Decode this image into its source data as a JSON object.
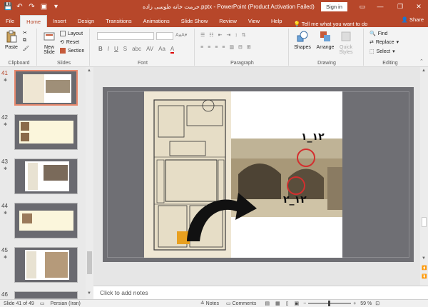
{
  "titlebar": {
    "title": "حرمت خانه طوسی زاده.pptx - PowerPoint (Product Activation Failed)",
    "signin": "Sign in",
    "qat_icons": [
      "save-icon",
      "undo-icon",
      "redo-icon",
      "present-icon",
      "customize-icon"
    ]
  },
  "tabs": [
    "File",
    "Home",
    "Insert",
    "Design",
    "Transitions",
    "Animations",
    "Slide Show",
    "Review",
    "View",
    "Help"
  ],
  "active_tab": "Home",
  "tellme": "Tell me what you want to do",
  "share": "Share",
  "ribbon": {
    "clipboard": {
      "paste": "Paste",
      "label": "Clipboard"
    },
    "slides": {
      "new_slide": "New Slide",
      "layout": "Layout",
      "reset": "Reset",
      "section": "Section",
      "label": "Slides"
    },
    "font": {
      "label": "Font",
      "format_buttons": [
        "B",
        "I",
        "U",
        "S",
        "abc",
        "AV",
        "Aa",
        "A"
      ]
    },
    "paragraph": {
      "label": "Paragraph"
    },
    "drawing": {
      "shapes": "Shapes",
      "arrange": "Arrange",
      "quick_styles": "Quick Styles",
      "label": "Drawing"
    },
    "editing": {
      "find": "Find",
      "replace": "Replace",
      "select": "Select",
      "label": "Editing"
    }
  },
  "thumbnails": [
    {
      "num": "41",
      "selected": true
    },
    {
      "num": "42",
      "selected": false
    },
    {
      "num": "43",
      "selected": false
    },
    {
      "num": "44",
      "selected": false
    },
    {
      "num": "45",
      "selected": false
    },
    {
      "num": "46",
      "selected": false
    }
  ],
  "slide": {
    "label_top": "۱۲_۱",
    "label_bottom": "۱۲_۲"
  },
  "notes_placeholder": "Click to add notes",
  "status": {
    "slide_of": "Slide 41 of 49",
    "language": "Persian (Iran)",
    "notes": "Notes",
    "comments": "Comments",
    "zoom": "59 %"
  },
  "colors": {
    "accent": "#b7472a",
    "highlight": "#e8a020",
    "circle": "#d32f2f"
  }
}
